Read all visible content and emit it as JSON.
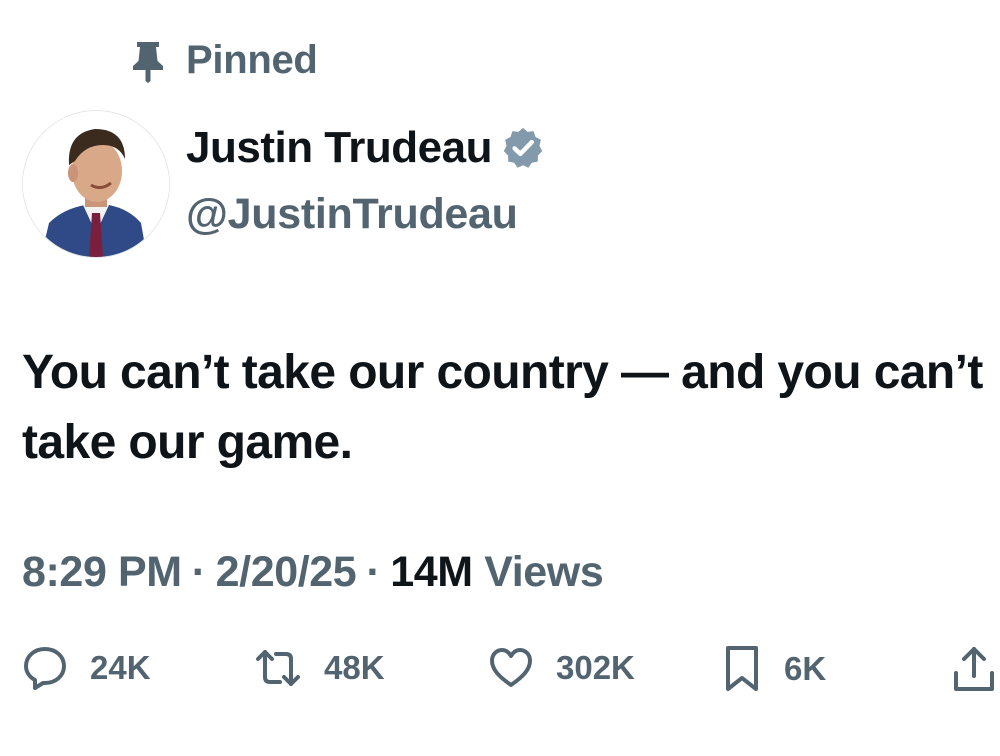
{
  "pinned": {
    "label": "Pinned",
    "icon": "pin-icon"
  },
  "author": {
    "name": "Justin Trudeau",
    "handle": "@JustinTrudeau",
    "verified": true,
    "verified_icon": "verified-badge-icon",
    "avatar_icon": "profile-photo"
  },
  "tweet": {
    "text": "You can’t take our country — and you can’t take our game."
  },
  "meta": {
    "time": "8:29 PM",
    "date": "2/20/25",
    "separator": "·",
    "views_count": "14M",
    "views_label": "Views"
  },
  "actions": {
    "reply": {
      "count": "24K",
      "icon": "reply-icon"
    },
    "retweet": {
      "count": "48K",
      "icon": "retweet-icon"
    },
    "like": {
      "count": "302K",
      "icon": "heart-icon"
    },
    "bookmark": {
      "count": "6K",
      "icon": "bookmark-icon"
    },
    "share": {
      "icon": "share-icon"
    }
  },
  "colors": {
    "primary_text": "#0f1419",
    "secondary_text": "#536471",
    "verified_badge": "#829aab",
    "background": "#ffffff"
  }
}
